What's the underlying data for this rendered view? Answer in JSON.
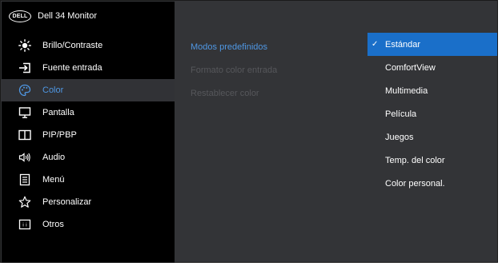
{
  "header": {
    "logo_text": "DELL",
    "title": "Dell 34 Monitor"
  },
  "menu": {
    "items": [
      {
        "label": "Brillo/Contraste",
        "icon": "brightness-icon"
      },
      {
        "label": "Fuente entrada",
        "icon": "input-source-icon"
      },
      {
        "label": "Color",
        "icon": "color-palette-icon",
        "selected": true
      },
      {
        "label": "Pantalla",
        "icon": "display-icon"
      },
      {
        "label": "PIP/PBP",
        "icon": "pip-pbp-icon"
      },
      {
        "label": "Audio",
        "icon": "audio-icon"
      },
      {
        "label": "Menú",
        "icon": "menu-icon"
      },
      {
        "label": "Personalizar",
        "icon": "star-icon"
      },
      {
        "label": "Otros",
        "icon": "others-icon"
      }
    ]
  },
  "submenu": {
    "items": [
      {
        "label": "Modos predefinidos",
        "active": true
      },
      {
        "label": "Formato color entrada",
        "active": false
      },
      {
        "label": "Restablecer color",
        "active": false
      }
    ]
  },
  "options": {
    "items": [
      {
        "label": "Estándar",
        "selected": true
      },
      {
        "label": "ComfortView"
      },
      {
        "label": "Multimedia"
      },
      {
        "label": "Película"
      },
      {
        "label": "Juegos"
      },
      {
        "label": "Temp. del color"
      },
      {
        "label": "Color personal."
      }
    ]
  },
  "colors": {
    "sidebar_bg": "#000000",
    "panel_bg": "#333437",
    "accent_text": "#4f97e3",
    "selected_option_bg": "#1a6fc9",
    "disabled_text": "#56575b"
  }
}
